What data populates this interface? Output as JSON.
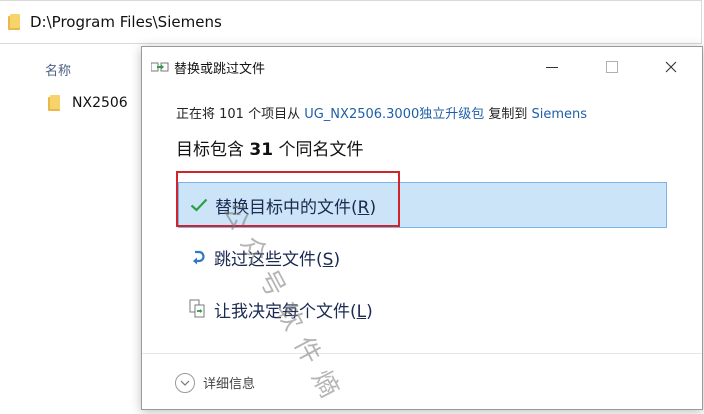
{
  "explorer": {
    "address_path": "D:\\Program Files\\Siemens",
    "column_header_name": "名称",
    "items": [
      {
        "name": "NX2506"
      }
    ]
  },
  "dialog": {
    "title": "替换或跳过文件",
    "info_prefix": "正在将 101 个项目从 ",
    "source": "UG_NX2506.3000独立升级包",
    "info_middle": " 复制到 ",
    "destination": "Siemens",
    "heading_prefix": "目标包含 ",
    "heading_count": "31",
    "heading_suffix": " 个同名文件",
    "options": [
      {
        "label": "替换目标中的文件(",
        "key": "R",
        "close": ")",
        "icon": "checkmark-icon"
      },
      {
        "label": "跳过这些文件(",
        "key": "S",
        "close": ")",
        "icon": "skip-arrow-icon"
      },
      {
        "label": "让我决定每个文件(",
        "key": "L",
        "close": ")",
        "icon": "compare-files-icon"
      }
    ],
    "details_label": "详细信息"
  },
  "watermark": {
    "text": "公众号软件熵"
  },
  "colors": {
    "selection_bg": "#cce4f7",
    "selection_border": "#7eb4ea",
    "highlight_box": "#d0232a",
    "link": "#1f5fa8",
    "check_green": "#2e9e44",
    "skip_blue": "#2f79c2"
  }
}
